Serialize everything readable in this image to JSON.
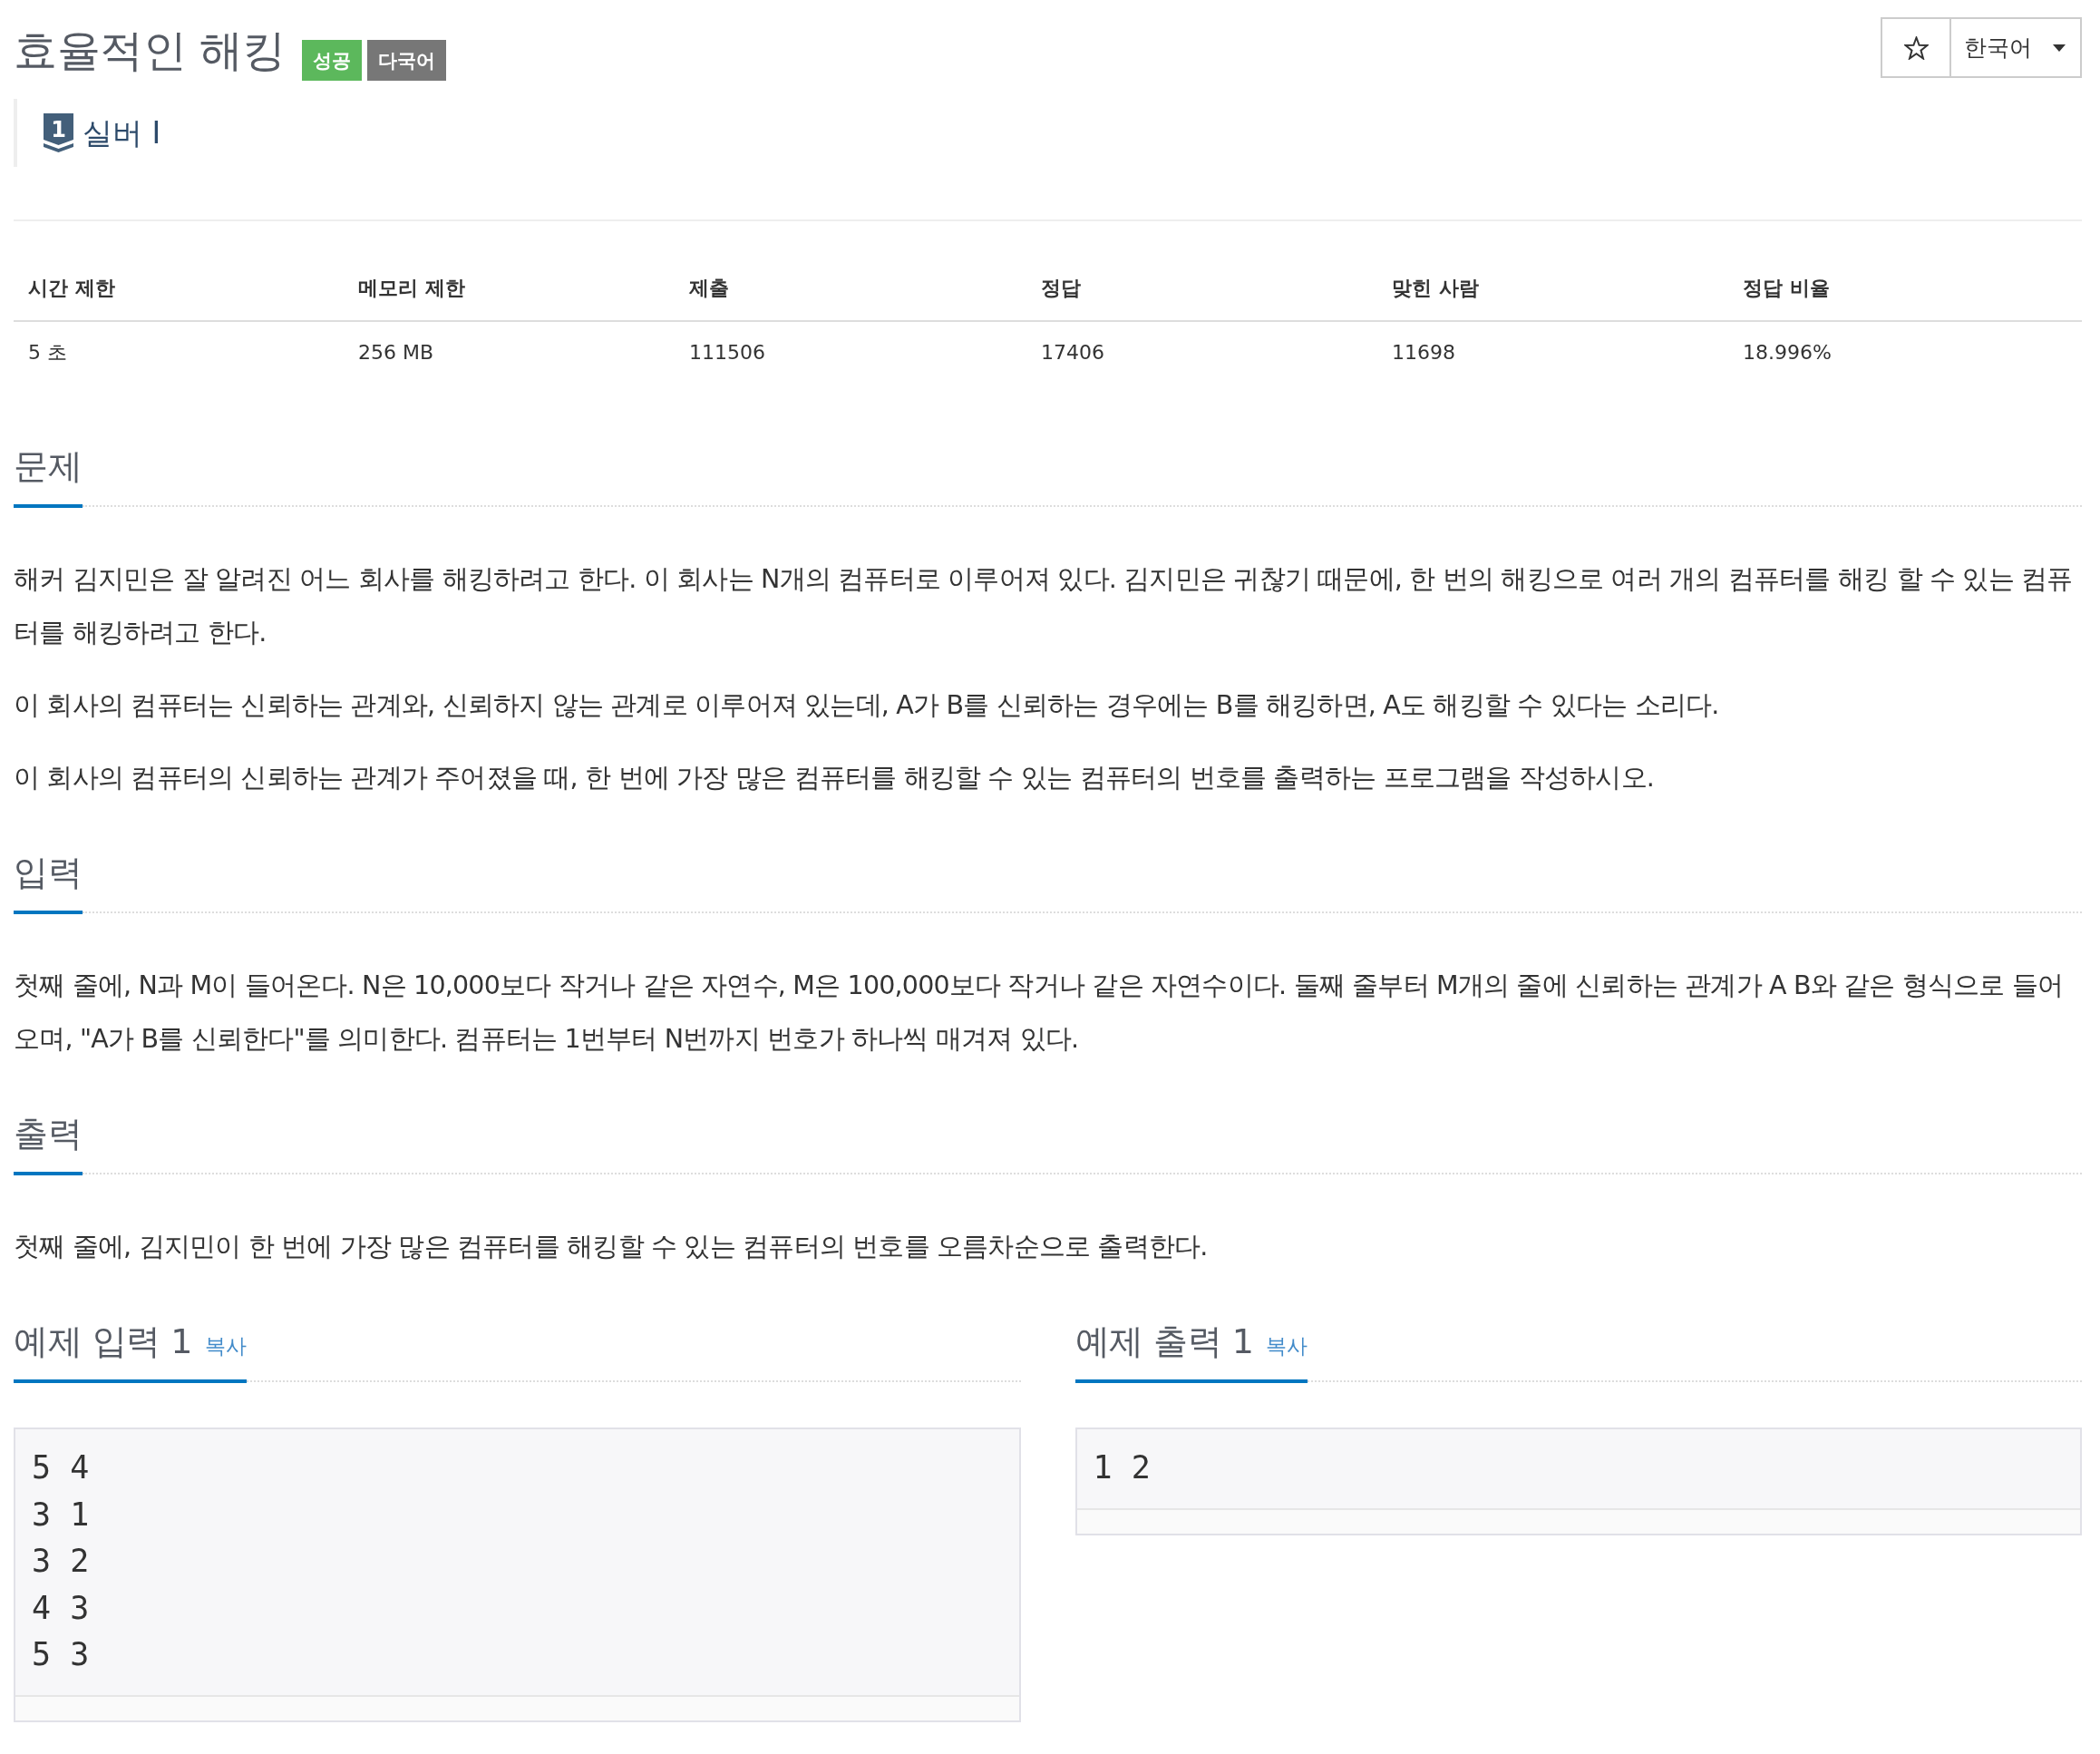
{
  "header": {
    "title": "효율적인 해킹",
    "labels": [
      {
        "text": "성공",
        "color": "#5cb85c"
      },
      {
        "text": "다국어",
        "color": "#777777"
      }
    ],
    "tier": {
      "badge": "1",
      "name": "실버 I"
    },
    "language": "한국어"
  },
  "info_table": {
    "columns": [
      "시간 제한",
      "메모리 제한",
      "제출",
      "정답",
      "맞힌 사람",
      "정답 비율"
    ],
    "rows": [
      [
        "5 초",
        "256 MB",
        "111506",
        "17406",
        "11698",
        "18.996%"
      ]
    ]
  },
  "sections": [
    {
      "title": "문제",
      "paragraphs": [
        "해커 김지민은 잘 알려진 어느 회사를 해킹하려고 한다. 이 회사는 N개의 컴퓨터로 이루어져 있다. 김지민은 귀찮기 때문에, 한 번의 해킹으로 여러 개의 컴퓨터를 해킹 할 수 있는 컴퓨터를 해킹하려고 한다.",
        "이 회사의 컴퓨터는 신뢰하는 관계와, 신뢰하지 않는 관계로 이루어져 있는데, A가 B를 신뢰하는 경우에는 B를 해킹하면, A도 해킹할 수 있다는 소리다.",
        "이 회사의 컴퓨터의 신뢰하는 관계가 주어졌을 때, 한 번에 가장 많은 컴퓨터를 해킹할 수 있는 컴퓨터의 번호를 출력하는 프로그램을 작성하시오."
      ]
    },
    {
      "title": "입력",
      "paragraphs": [
        "첫째 줄에, N과 M이 들어온다. N은 10,000보다 작거나 같은 자연수, M은 100,000보다 작거나 같은 자연수이다. 둘째 줄부터 M개의 줄에 신뢰하는 관계가 A B와 같은 형식으로 들어오며, \"A가 B를 신뢰한다\"를 의미한다. 컴퓨터는 1번부터 N번까지 번호가 하나씩 매겨져 있다."
      ]
    },
    {
      "title": "출력",
      "paragraphs": [
        "첫째 줄에, 김지민이 한 번에 가장 많은 컴퓨터를 해킹할 수 있는 컴퓨터의 번호를 오름차순으로 출력한다."
      ]
    }
  ],
  "samples": [
    {
      "title": "예제 입력 1",
      "copy": "복사",
      "text": "5 4\n3 1\n3 2\n4 3\n5 3"
    },
    {
      "title": "예제 출력 1",
      "copy": "복사",
      "text": "1 2"
    }
  ]
}
